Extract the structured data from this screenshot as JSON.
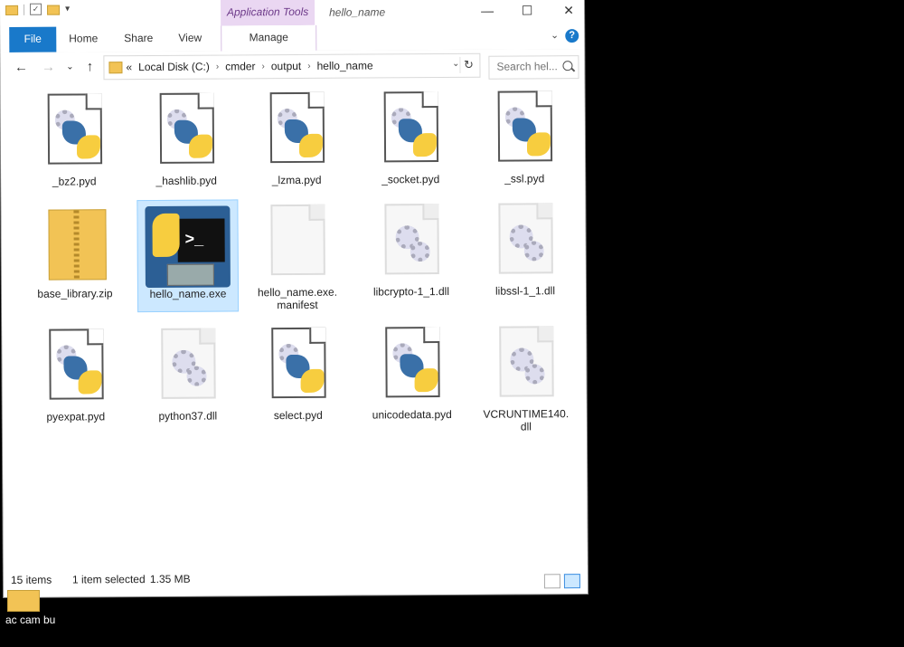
{
  "window": {
    "title": "hello_name",
    "context_tab": "Application Tools",
    "minimize": "—",
    "maximize": "☐",
    "close": "✕"
  },
  "ribbon": {
    "tabs": [
      "File",
      "Home",
      "Share",
      "View",
      "Manage"
    ],
    "help": "?"
  },
  "address": {
    "crumbs": [
      "«",
      "Local Disk (C:)",
      "cmder",
      "output",
      "hello_name"
    ],
    "search_placeholder": "Search hel..."
  },
  "files": [
    {
      "name": "_bz2.pyd",
      "type": "pyd"
    },
    {
      "name": "_hashlib.pyd",
      "type": "pyd"
    },
    {
      "name": "_lzma.pyd",
      "type": "pyd"
    },
    {
      "name": "_socket.pyd",
      "type": "pyd"
    },
    {
      "name": "_ssl.pyd",
      "type": "pyd"
    },
    {
      "name": "base_library.zip",
      "type": "zip"
    },
    {
      "name": "hello_name.exe",
      "type": "exe",
      "selected": true
    },
    {
      "name": "hello_name.exe.\nmanifest",
      "type": "manifest"
    },
    {
      "name": "libcrypto-1_1.dll",
      "type": "dll"
    },
    {
      "name": "libssl-1_1.dll",
      "type": "dll"
    },
    {
      "name": "pyexpat.pyd",
      "type": "pyd"
    },
    {
      "name": "python37.dll",
      "type": "dll"
    },
    {
      "name": "select.pyd",
      "type": "pyd"
    },
    {
      "name": "unicodedata.pyd",
      "type": "pyd"
    },
    {
      "name": "VCRUNTIME140.\ndll",
      "type": "dll"
    }
  ],
  "status": {
    "count": "15 items",
    "selected": "1 item selected",
    "size": "1.35 MB"
  },
  "desktop": {
    "label": "ac cam bu"
  },
  "colors": {
    "file_tab": "#1979ca",
    "context_tab": "#ead7f2",
    "selection": "#cce8ff"
  }
}
